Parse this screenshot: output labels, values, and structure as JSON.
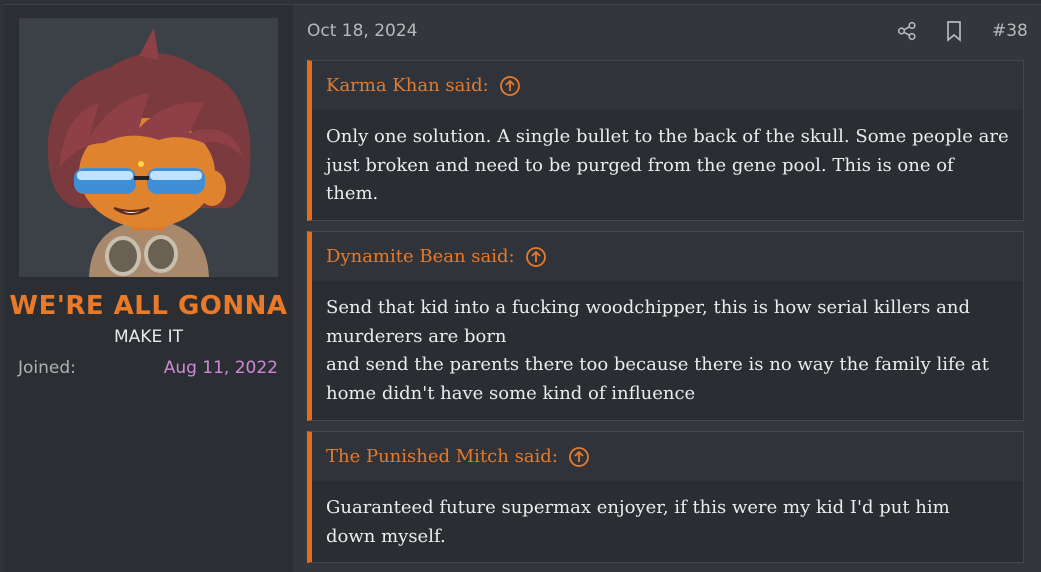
{
  "user": {
    "title": "WE'RE ALL GONNA",
    "subtitle": "MAKE IT",
    "joined_label": "Joined:",
    "joined_value": "Aug 11, 2022"
  },
  "post": {
    "date": "Oct 18, 2024",
    "number": "#38",
    "quotes": [
      {
        "author": "Karma Khan said:",
        "lines": [
          "Only one solution. A single bullet to the back of the skull. Some people are",
          "just broken and need to be purged from the gene pool. This is one of",
          "them."
        ]
      },
      {
        "author": "Dynamite Bean said:",
        "lines": [
          "Send that kid into a fucking woodchipper, this is how serial killers and",
          "murderers are born",
          "and send the parents there too because there is no way the family life at",
          "home didn't have some kind of influence"
        ]
      },
      {
        "author": "The Punished Mitch said:",
        "lines": [
          "Guaranteed future supermax enjoyer, if this were my kid I'd put him",
          "down myself."
        ]
      }
    ]
  },
  "colors": {
    "accent": "#e26d1c",
    "joined_date": "#cf88d6",
    "background": "#33373d"
  },
  "icons": [
    "share-icon",
    "bookmark-icon",
    "arrow-up-circle-icon"
  ]
}
